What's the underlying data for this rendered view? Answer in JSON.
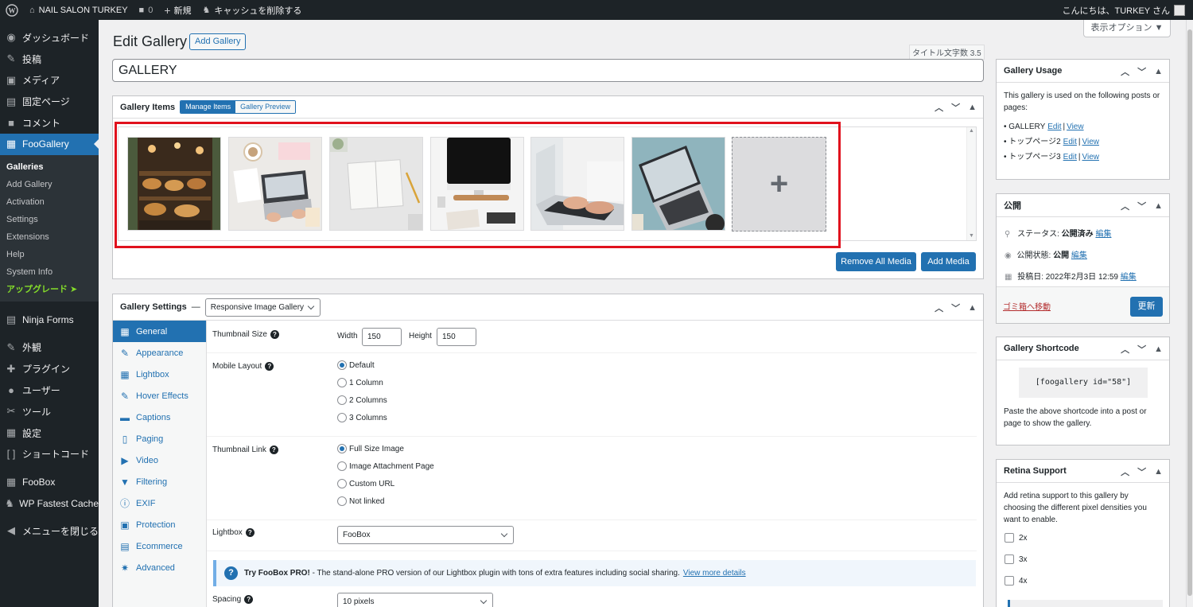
{
  "adminbar": {
    "site_name": "NAIL SALON TURKEY",
    "comments_count": "0",
    "new_label": "新規",
    "cache_label": "キャッシュを削除する",
    "greeting": "こんにちは、TURKEY さん"
  },
  "sidebar": {
    "items_top": [
      {
        "label": "ダッシュボード",
        "icon": "dashboard-icon",
        "glyph": "◉"
      },
      {
        "label": "投稿",
        "icon": "pin-icon",
        "glyph": "✎"
      },
      {
        "label": "メディア",
        "icon": "media-icon",
        "glyph": "▣"
      },
      {
        "label": "固定ページ",
        "icon": "page-icon",
        "glyph": "▤"
      },
      {
        "label": "コメント",
        "icon": "comment-icon",
        "glyph": "■"
      }
    ],
    "active_item": {
      "label": "FooGallery",
      "icon": "foogallery-icon",
      "glyph": "▦"
    },
    "submenu": [
      "Galleries",
      "Add Gallery",
      "Activation",
      "Settings",
      "Extensions",
      "Help",
      "System Info"
    ],
    "upgrade_label": "アップグレード ➤",
    "items_bottom": [
      {
        "label": "Ninja Forms",
        "icon": "ninja-forms-icon",
        "glyph": "▤"
      },
      {
        "label": "外観",
        "icon": "appearance-icon",
        "glyph": "✎"
      },
      {
        "label": "プラグイン",
        "icon": "plugin-icon",
        "glyph": "✚"
      },
      {
        "label": "ユーザー",
        "icon": "user-icon",
        "glyph": "●"
      },
      {
        "label": "ツール",
        "icon": "tool-icon",
        "glyph": "✂"
      },
      {
        "label": "設定",
        "icon": "settings-icon",
        "glyph": "▦"
      },
      {
        "label": "ショートコード",
        "icon": "shortcode-icon",
        "glyph": "[ ]"
      },
      {
        "label": "FooBox",
        "icon": "foobox-icon",
        "glyph": "▦"
      },
      {
        "label": "WP Fastest Cache",
        "icon": "cheetah-icon",
        "glyph": "♞"
      },
      {
        "label": "メニューを閉じる",
        "icon": "collapse-icon",
        "glyph": "◀"
      }
    ]
  },
  "header": {
    "title": "Edit Gallery",
    "add_gallery": "Add Gallery",
    "screen_options": "表示オプション ▼",
    "char_count": "タイトル文字数 3.5",
    "title_value": "GALLERY"
  },
  "gallery_items": {
    "title": "Gallery Items",
    "manage_tab": "Manage Items",
    "preview_tab": "Gallery Preview",
    "thumbs": [
      {
        "name": "bakery-thumbnail"
      },
      {
        "name": "desk-laptop-thumbnail"
      },
      {
        "name": "open-notebook-thumbnail"
      },
      {
        "name": "imac-desk-thumbnail"
      },
      {
        "name": "typing-laptop-thumbnail"
      },
      {
        "name": "laptop-teal-thumbnail"
      }
    ],
    "add_tile": "+",
    "remove_all": "Remove All Media",
    "add_media": "Add Media"
  },
  "settings": {
    "title": "Gallery Settings",
    "dash": "—",
    "template": "Responsive Image Gallery",
    "tabs": [
      {
        "label": "General",
        "icon": "gear-icon",
        "glyph": "▦"
      },
      {
        "label": "Appearance",
        "icon": "brush-icon",
        "glyph": "✎"
      },
      {
        "label": "Lightbox",
        "icon": "grid-icon",
        "glyph": "▦"
      },
      {
        "label": "Hover Effects",
        "icon": "wrench-icon",
        "glyph": "✎"
      },
      {
        "label": "Captions",
        "icon": "caption-icon",
        "glyph": "▬"
      },
      {
        "label": "Paging",
        "icon": "paging-icon",
        "glyph": "▯"
      },
      {
        "label": "Video",
        "icon": "video-icon",
        "glyph": "▶"
      },
      {
        "label": "Filtering",
        "icon": "filter-icon",
        "glyph": "▼"
      },
      {
        "label": "EXIF",
        "icon": "info-icon",
        "glyph": "ⓘ"
      },
      {
        "label": "Protection",
        "icon": "lock-icon",
        "glyph": "▣"
      },
      {
        "label": "Ecommerce",
        "icon": "cart-icon",
        "glyph": "▤"
      },
      {
        "label": "Advanced",
        "icon": "cog-icon",
        "glyph": "✷"
      }
    ],
    "thumb_size_label": "Thumbnail Size",
    "width_label": "Width",
    "width_value": "150",
    "height_label": "Height",
    "height_value": "150",
    "mobile_layout_label": "Mobile Layout",
    "mobile_options": [
      "Default",
      "1 Column",
      "2 Columns",
      "3 Columns"
    ],
    "thumb_link_label": "Thumbnail Link",
    "link_options": [
      "Full Size Image",
      "Image Attachment Page",
      "Custom URL",
      "Not linked"
    ],
    "lightbox_label": "Lightbox",
    "lightbox_value": "FooBox",
    "notice_bold": "Try FooBox PRO!",
    "notice_text": " - The stand-alone PRO version of our Lightbox plugin with tons of extra features including social sharing.",
    "notice_link": "View more details",
    "spacing_label": "Spacing",
    "spacing_value": "10 pixels"
  },
  "usage_box": {
    "title": "Gallery Usage",
    "desc": "This gallery is used on the following posts or pages:",
    "items": [
      {
        "name": "GALLERY",
        "edit": "Edit",
        "sep": "|",
        "view": "View"
      },
      {
        "name": "トップページ2",
        "edit": "Edit",
        "sep": "|",
        "view": "View"
      },
      {
        "name": "トップページ3",
        "edit": "Edit",
        "sep": "|",
        "view": "View"
      }
    ]
  },
  "publish_box": {
    "title": "公開",
    "status_label": "ステータス:",
    "status_value": "公開済み",
    "visibility_label": "公開状態:",
    "visibility_value": "公開",
    "date_label": "投稿日:",
    "date_value": "2022年2月3日 12:59",
    "edit": "編集",
    "trash": "ゴミ箱へ移動",
    "update": "更新"
  },
  "shortcode_box": {
    "title": "Gallery Shortcode",
    "code": "[foogallery id=\"58\"]",
    "desc": "Paste the above shortcode into a post or page to show the gallery."
  },
  "retina_box": {
    "title": "Retina Support",
    "desc": "Add retina support to this gallery by choosing the different pixel densities you want to enable.",
    "options": [
      "2x",
      "3x",
      "4x"
    ]
  },
  "colors": {
    "admin_bar": "#1d2327",
    "accent": "#2271b1",
    "highlight_border": "#e0111d",
    "upgrade": "#84dc2a"
  }
}
